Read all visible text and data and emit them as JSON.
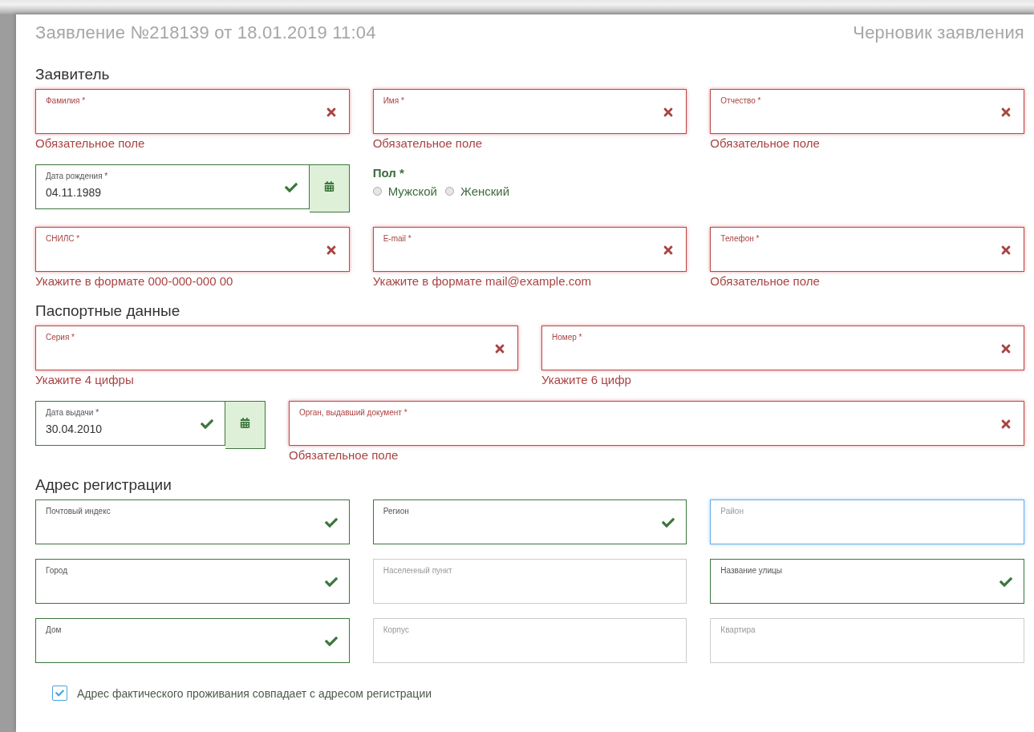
{
  "header": {
    "title": "Заявление №218139 от 18.01.2019 11:04",
    "status": "Черновик заявления"
  },
  "sections": [
    {
      "heading": "Заявитель",
      "rows": [
        [
          {
            "kind": "text",
            "label": "Фамилия *",
            "error": true,
            "valid": false,
            "focused": false,
            "message": "Обязательное поле"
          },
          {
            "kind": "text",
            "label": "Имя *",
            "error": true,
            "valid": false,
            "focused": false,
            "message": "Обязательное поле"
          },
          {
            "kind": "text",
            "label": "Отчество *",
            "error": true,
            "valid": false,
            "focused": false,
            "message": "Обязательное поле"
          }
        ],
        [
          {
            "kind": "date",
            "label": "Дата рождения *",
            "value": "04.11.1989",
            "error": false,
            "valid": true,
            "focused": false
          },
          {
            "kind": "radio-group",
            "label": "Пол *",
            "options": [
              {
                "label": "Мужской",
                "selected": false
              },
              {
                "label": "Женский",
                "selected": false
              }
            ]
          }
        ],
        [
          {
            "kind": "text",
            "label": "СНИЛС *",
            "error": true,
            "valid": false,
            "focused": false,
            "message": "Укажите в формате 000-000-000 00"
          },
          {
            "kind": "text",
            "label": "E-mail *",
            "error": true,
            "valid": false,
            "focused": false,
            "message": "Укажите в формате mail@example.com"
          },
          {
            "kind": "text",
            "label": "Телефон *",
            "error": true,
            "valid": false,
            "focused": false,
            "message": "Обязательное поле"
          }
        ]
      ]
    },
    {
      "heading": "Паспортные данные",
      "rows": [
        [
          {
            "kind": "text",
            "label": "Серия *",
            "error": true,
            "valid": false,
            "focused": false,
            "message": "Укажите 4 цифры"
          },
          {
            "kind": "text",
            "label": "Номер *",
            "error": true,
            "valid": false,
            "focused": false,
            "message": "Укажите 6 цифр"
          }
        ],
        [
          {
            "kind": "date",
            "label": "Дата выдачи *",
            "value": "30.04.2010",
            "error": false,
            "valid": true,
            "focused": false
          },
          {
            "kind": "text",
            "label": "Орган, выдавший документ *",
            "error": true,
            "valid": false,
            "focused": false,
            "message": "Обязательное поле"
          }
        ]
      ]
    },
    {
      "heading": "Адрес регистрации",
      "rows": [
        [
          {
            "kind": "text",
            "label": "Почтовый индекс",
            "error": false,
            "valid": true,
            "focused": false
          },
          {
            "kind": "text",
            "label": "Регион",
            "error": false,
            "valid": true,
            "focused": false
          },
          {
            "kind": "text",
            "label": "Район",
            "error": false,
            "valid": false,
            "focused": true
          }
        ],
        [
          {
            "kind": "text",
            "label": "Город",
            "error": false,
            "valid": true,
            "focused": false
          },
          {
            "kind": "text",
            "label": "Населенный пункт",
            "error": false,
            "valid": false,
            "focused": false
          },
          {
            "kind": "text",
            "label": "Название улицы",
            "error": false,
            "valid": true,
            "focused": false
          }
        ],
        [
          {
            "kind": "text",
            "label": "Дом",
            "error": false,
            "valid": true,
            "focused": false
          },
          {
            "kind": "text",
            "label": "Корпус",
            "error": false,
            "valid": false,
            "focused": false
          },
          {
            "kind": "text",
            "label": "Квартира",
            "error": false,
            "valid": false,
            "focused": false
          }
        ]
      ]
    }
  ],
  "checkbox": {
    "label": "Адрес фактического проживания совпадает с адресом регистрации",
    "checked": true
  }
}
